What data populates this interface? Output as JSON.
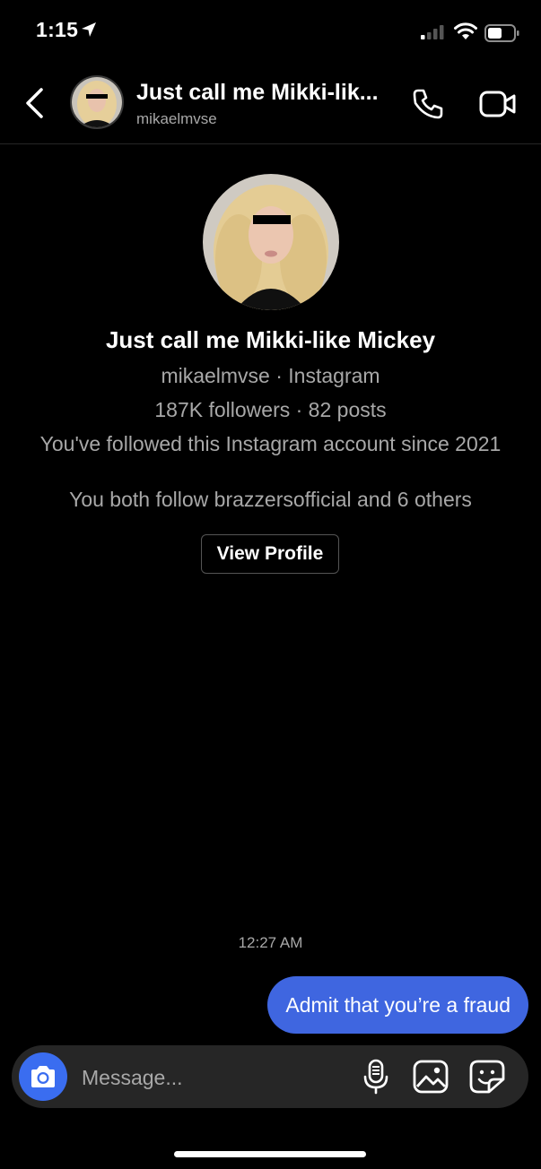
{
  "status_bar": {
    "time": "1:15",
    "icons": [
      "location-arrow-icon",
      "cellular-signal-icon",
      "wifi-icon",
      "battery-icon"
    ]
  },
  "header": {
    "back_icon": "chevron-left-icon",
    "display_name": "Just call me Mikki-lik...",
    "username": "mikaelmvse",
    "call_icon": "phone-icon",
    "video_icon": "video-camera-icon"
  },
  "profile": {
    "name": "Just call me Mikki-like Mickey",
    "subtitle": "mikaelmvse · Instagram",
    "stats": "187K followers · 82 posts",
    "followed_since": "You've followed this Instagram account since 2021",
    "mutual": "You both follow brazzersofficial and 6 others",
    "view_profile_label": "View Profile"
  },
  "conversation": {
    "timestamp": "12:27 AM",
    "messages": [
      {
        "sender": "me",
        "text": "Admit that you’re a fraud"
      }
    ]
  },
  "composer": {
    "placeholder": "Message...",
    "icons": [
      "camera-icon",
      "microphone-icon",
      "gallery-icon",
      "sticker-icon"
    ]
  },
  "colors": {
    "background": "#000000",
    "accent": "#3f66e0",
    "secondary_text": "#a8a8a8",
    "composer_bg": "#262626"
  }
}
